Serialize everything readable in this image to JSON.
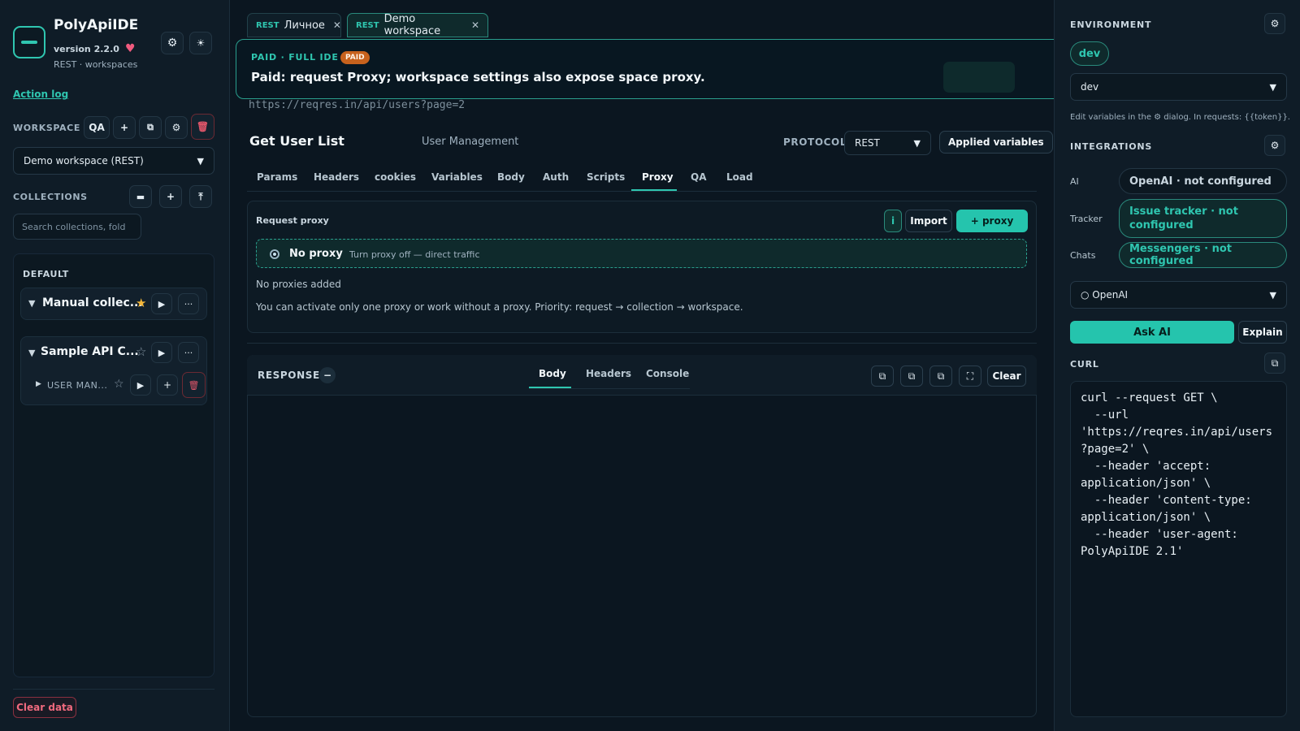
{
  "app": {
    "name": "PolyApiIDE",
    "version": "version 2.2.0",
    "subtitle": "REST · workspaces",
    "action_log": "Action log"
  },
  "workspace": {
    "label": "WORKSPACE",
    "role": "QA",
    "selected": "Demo workspace (REST)"
  },
  "collections": {
    "label": "COLLECTIONS",
    "search_placeholder": "Search collections, fold",
    "group": "DEFAULT",
    "items": [
      {
        "name": "Manual collec...",
        "starred": true
      },
      {
        "name": "Sample API C...",
        "starred": false,
        "children": [
          {
            "name": "USER MAN..."
          }
        ]
      }
    ]
  },
  "left_footer": {
    "clear_data": "Clear data"
  },
  "tabs": [
    {
      "protocol": "REST",
      "label": "Личное"
    },
    {
      "protocol": "REST",
      "label": "Demo workspace"
    }
  ],
  "banner": {
    "kicker": "PAID · FULL IDE",
    "badge": "PAID",
    "message": "Paid: request Proxy; workspace settings also expose space proxy."
  },
  "request": {
    "url": "https://reqres.in/api/users?page=2",
    "title": "Get User List",
    "folder": "User Management",
    "protocol_label": "PROTOCOL",
    "protocol": "REST",
    "applied_variables": "Applied variables",
    "tabs": [
      "Params",
      "Headers",
      "cookies",
      "Variables",
      "Body",
      "Auth",
      "Scripts",
      "Proxy",
      "QA",
      "Load"
    ],
    "active_tab": "Proxy"
  },
  "proxy": {
    "heading": "Request proxy",
    "info": "i",
    "import": "Import",
    "add": "+ proxy",
    "no_proxy_title": "No proxy",
    "no_proxy_desc": "Turn proxy off — direct traffic",
    "empty": "No proxies added",
    "note": "You can activate only one proxy or work without a proxy. Priority: request → collection → workspace."
  },
  "response": {
    "label": "RESPONSE",
    "tabs": [
      "Body",
      "Headers",
      "Console"
    ],
    "clear": "Clear"
  },
  "environment": {
    "label": "ENVIRONMENT",
    "chip": "dev",
    "selected": "dev",
    "help": "Edit variables in the ⚙ dialog. In requests: {{token}}."
  },
  "integrations": {
    "label": "INTEGRATIONS",
    "items": [
      {
        "name": "AI",
        "value": "OpenAI · not configured"
      },
      {
        "name": "Tracker",
        "value": "Issue tracker · not configured"
      },
      {
        "name": "Chats",
        "value": "Messengers · not configured"
      }
    ],
    "provider": "○ OpenAI",
    "ask": "Ask AI",
    "explain": "Explain"
  },
  "curl": {
    "label": "CURL",
    "lines": [
      "curl --request GET \\",
      "  --url",
      "'https://reqres.in/api/users",
      "?page=2' \\",
      "  --header 'accept:",
      "application/json' \\",
      "  --header 'content-type:",
      "application/json' \\",
      "  --header 'user-agent:",
      "PolyApiIDE 2.1'"
    ]
  },
  "colors": {
    "accent": "#2fc6b0",
    "background": "#0b1620",
    "danger": "#f06a7e",
    "paid_badge": "#c7621d"
  }
}
